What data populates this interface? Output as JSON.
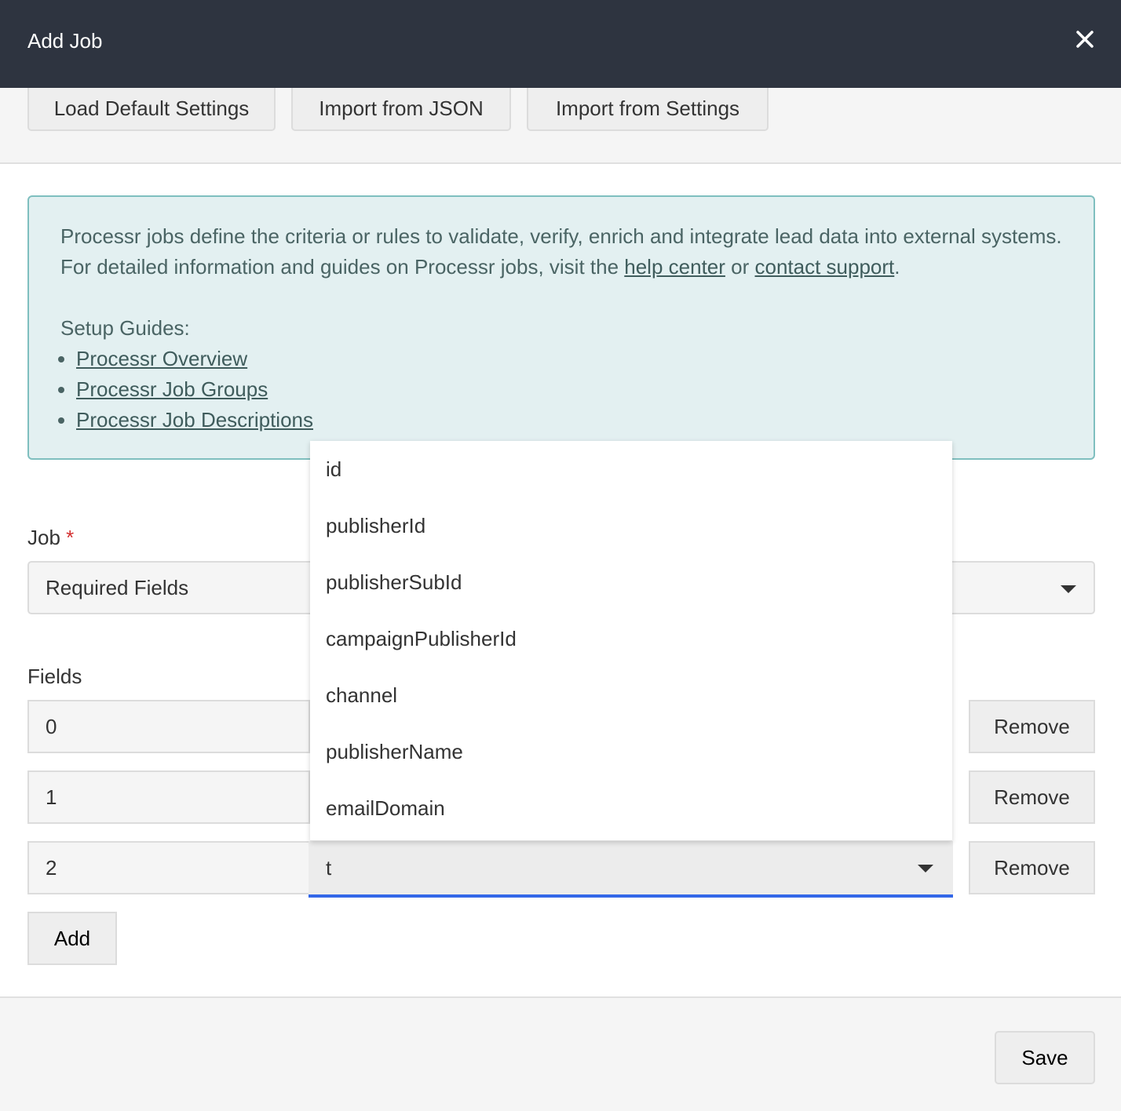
{
  "header": {
    "title": "Add Job",
    "close_icon": "close-icon"
  },
  "toolbar": {
    "load_default": "Load Default Settings",
    "import_json": "Import from JSON",
    "import_settings": "Import from Settings"
  },
  "info": {
    "line1": "Processr jobs define the criteria or rules to validate, verify, enrich and integrate lead data into external systems.",
    "line2_prefix": "For detailed information and guides on Processr jobs, visit the ",
    "help_link": "help center",
    "or": " or ",
    "contact_link": "contact support",
    "period": ".",
    "guides_title": "Setup Guides:",
    "guides": [
      "Processr Overview",
      "Processr Job Groups",
      "Processr Job Descriptions"
    ]
  },
  "job": {
    "label": "Job",
    "required_mark": "*",
    "value": "Required Fields"
  },
  "fields": {
    "label": "Fields",
    "rows": [
      {
        "index": "0",
        "remove": "Remove"
      },
      {
        "index": "1",
        "remove": "Remove"
      },
      {
        "index": "2",
        "value": "t",
        "remove": "Remove"
      }
    ],
    "add": "Add"
  },
  "dropdown": {
    "options": [
      "id",
      "publisherId",
      "publisherSubId",
      "campaignPublisherId",
      "channel",
      "publisherName",
      "emailDomain"
    ]
  },
  "footer": {
    "save": "Save"
  }
}
